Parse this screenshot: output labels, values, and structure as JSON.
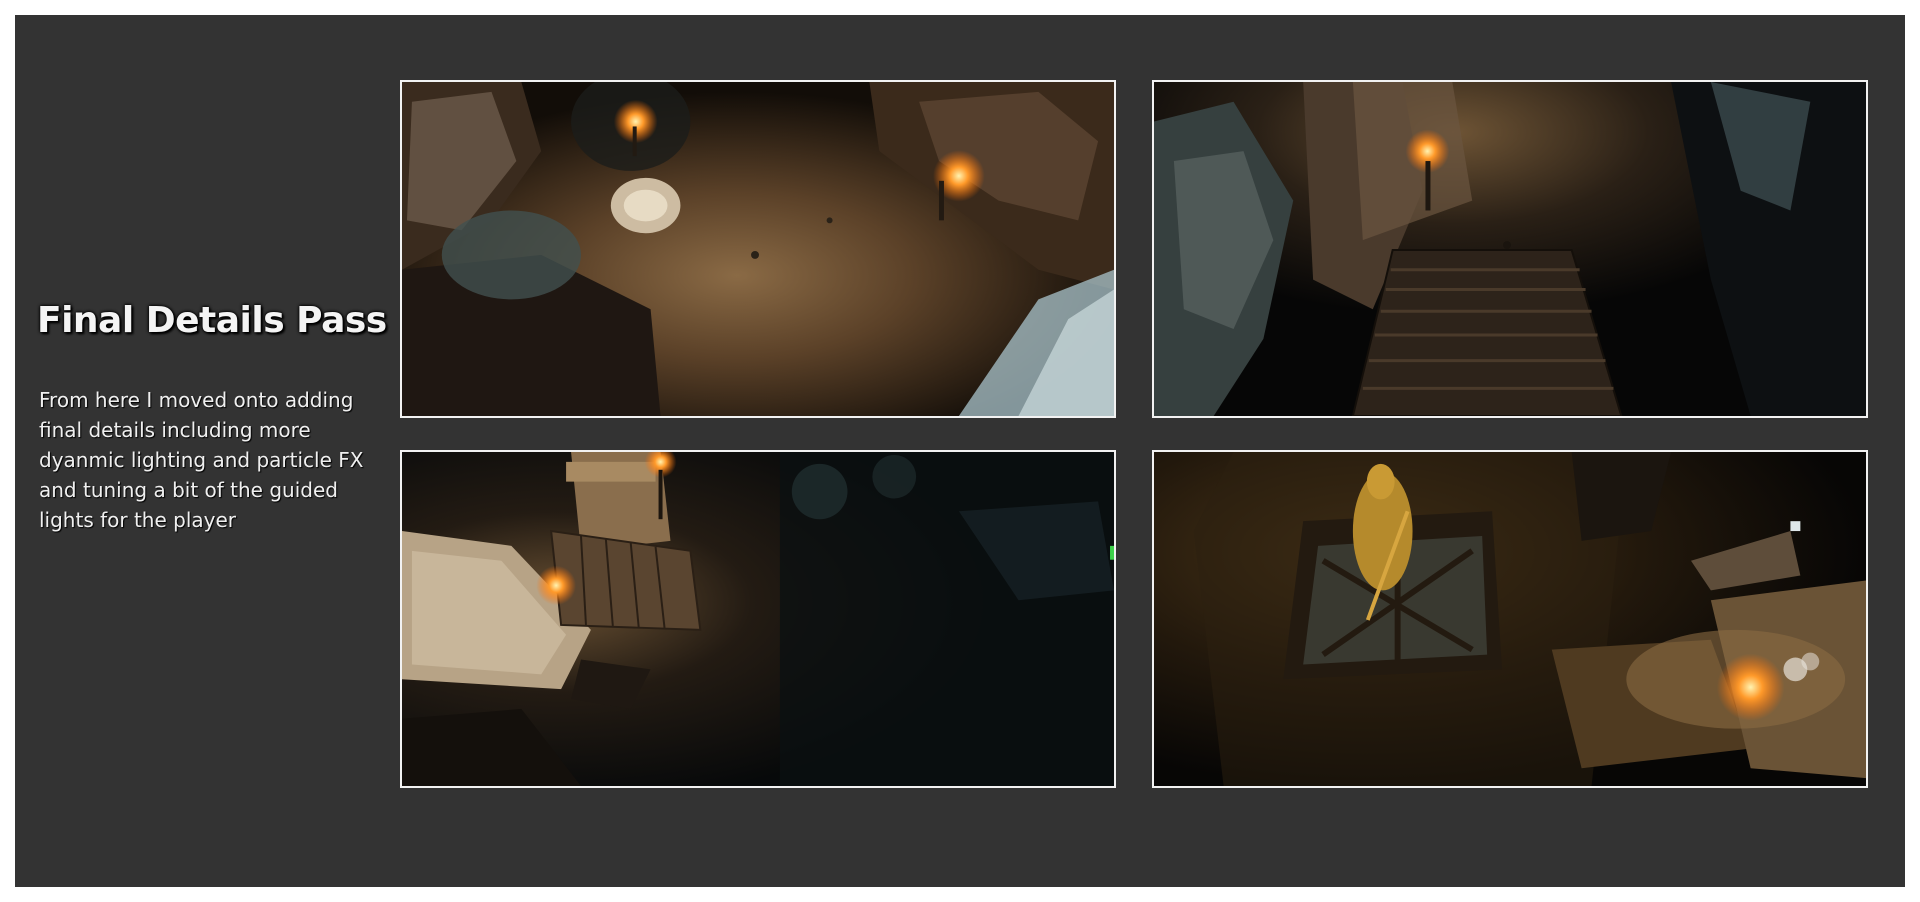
{
  "slide": {
    "title": "Final Details Pass",
    "description": "From here I moved onto adding final details including more dyanmic lighting and particle FX and tuning a bit of the guided lights for the player",
    "background_color": "#333333",
    "frame_color": "#f2f2f2"
  },
  "screenshots": [
    {
      "subject": "torch-lit forest path with rocks and frosted trees"
    },
    {
      "subject": "wooden staircase between dark rock cliffs"
    },
    {
      "subject": "ruined stone platform with wooden steps and torches"
    },
    {
      "subject": "golden statue on engraved floor with torch pedestal"
    }
  ]
}
